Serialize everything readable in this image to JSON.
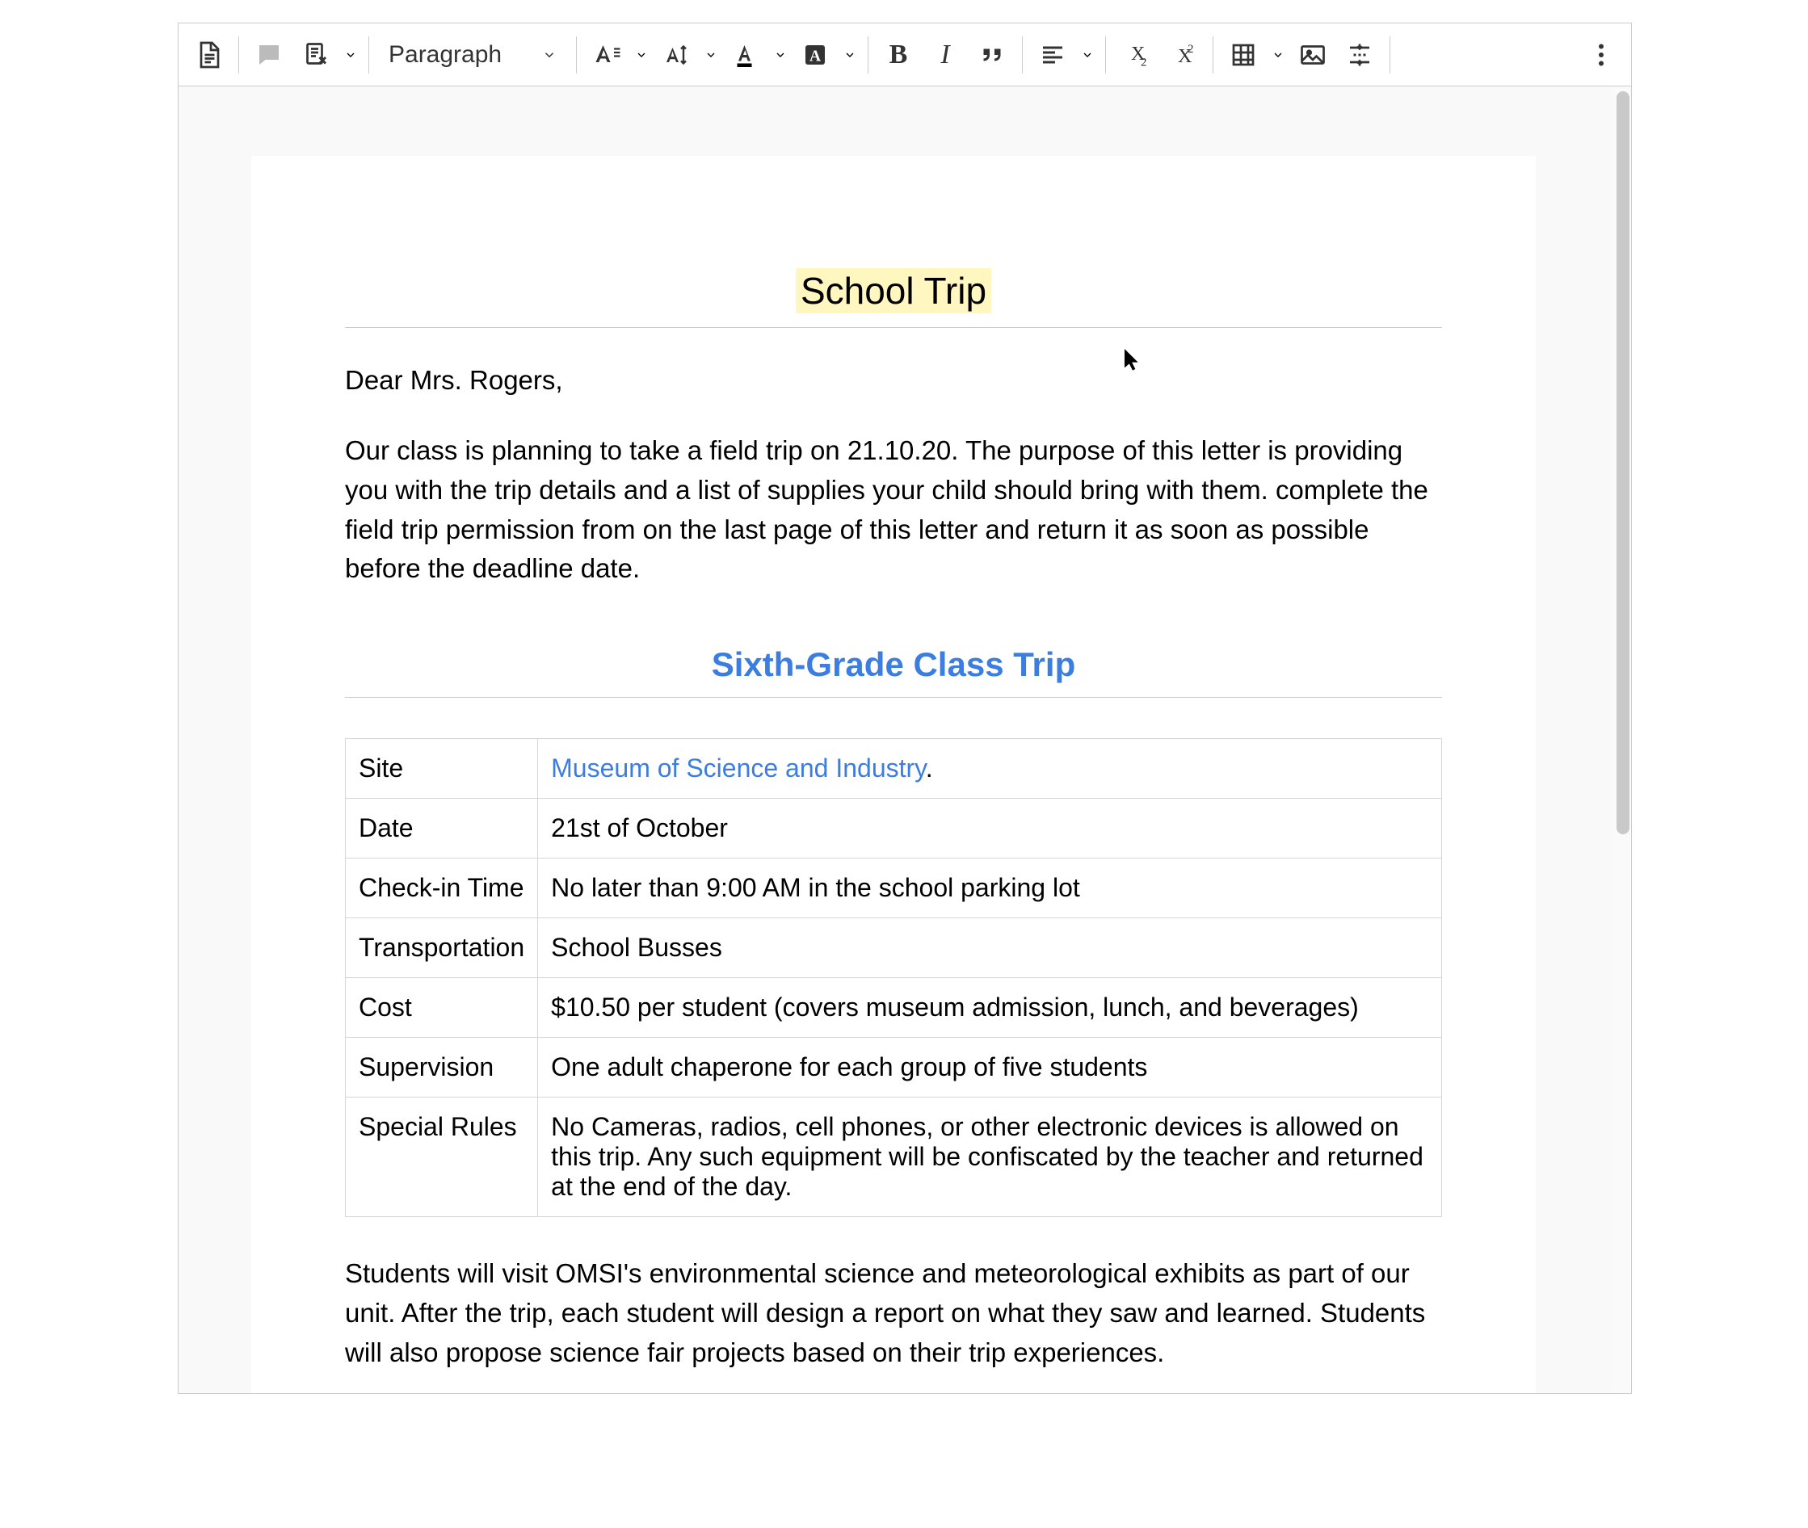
{
  "toolbar": {
    "paragraph_style": "Paragraph"
  },
  "document": {
    "title": "School Trip",
    "salutation": "Dear Mrs. Rogers,",
    "intro": "Our class is planning to take a field trip on 21.10.20. The purpose of this letter is providing you with the trip details and a list of supplies your child should bring with them. complete the field trip permission from on the last page of this letter and return it as soon as possible before the deadline date.",
    "subheading": "Sixth-Grade Class Trip",
    "table": {
      "rows": [
        {
          "label": "Site",
          "link": "Museum of Science and Industry",
          "after": "."
        },
        {
          "label": "Date",
          "value": "21st of October"
        },
        {
          "label": "Check-in Time",
          "value": "No later than 9:00 AM in the school parking lot"
        },
        {
          "label": "Transportation",
          "value": "School Busses"
        },
        {
          "label": "Cost",
          "value": "$10.50 per student (covers museum admission, lunch, and beverages)"
        },
        {
          "label": "Supervision",
          "value": "One adult chaperone for each group of five students"
        },
        {
          "label": "Special Rules",
          "value": "No Cameras, radios, cell phones, or other electronic devices is allowed on this trip. Any such equipment will be confiscated by the teacher and returned at the end of the day."
        }
      ]
    },
    "closing": "Students will visit OMSI's environmental science and meteorological exhibits as part of our unit. After the trip, each student will design a report on what they saw and learned. Students will also propose science fair projects based on their trip experiences."
  }
}
